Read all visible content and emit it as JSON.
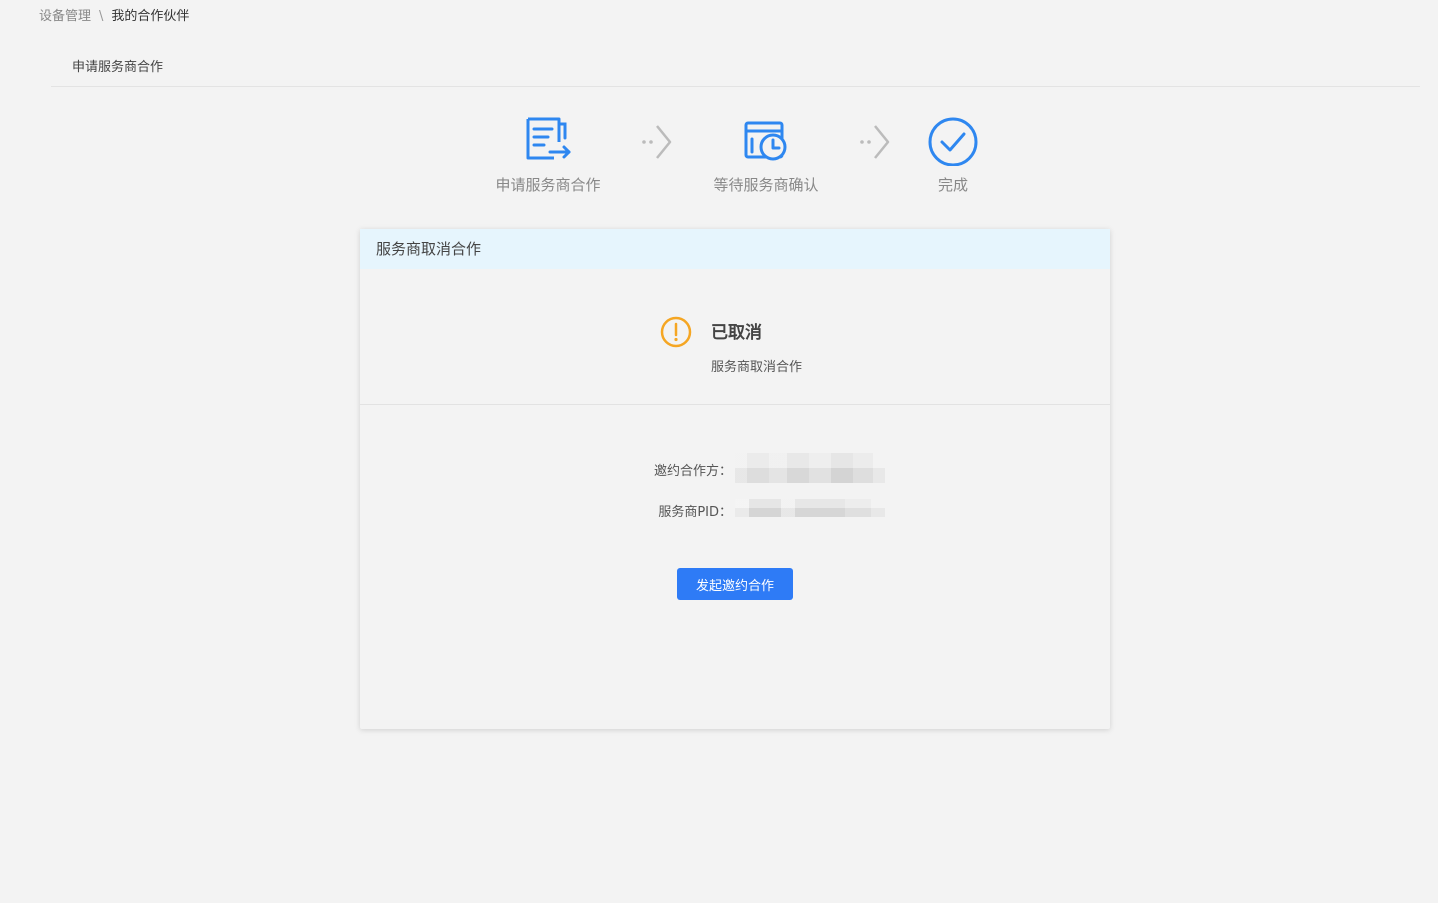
{
  "breadcrumb": {
    "parent": "设备管理",
    "separator": "\\",
    "current": "我的合作伙伴"
  },
  "section": {
    "title": "申请服务商合作"
  },
  "steps": [
    {
      "label": "申请服务商合作",
      "icon": "apply-document-icon"
    },
    {
      "label": "等待服务商确认",
      "icon": "calendar-clock-icon"
    },
    {
      "label": "完成",
      "icon": "check-circle-icon"
    }
  ],
  "card": {
    "header": "服务商取消合作",
    "status_title": "已取消",
    "status_desc": "服务商取消合作",
    "fields": [
      {
        "label": "邀约合作方：",
        "value": ""
      },
      {
        "label": "服务商PID：",
        "value": ""
      }
    ],
    "button_label": "发起邀约合作"
  },
  "colors": {
    "primary": "#2e7bf6",
    "icon_blue": "#2e87f0",
    "warning": "#f5a623",
    "header_bg": "#e6f5fd",
    "page_bg": "#f3f3f3"
  }
}
